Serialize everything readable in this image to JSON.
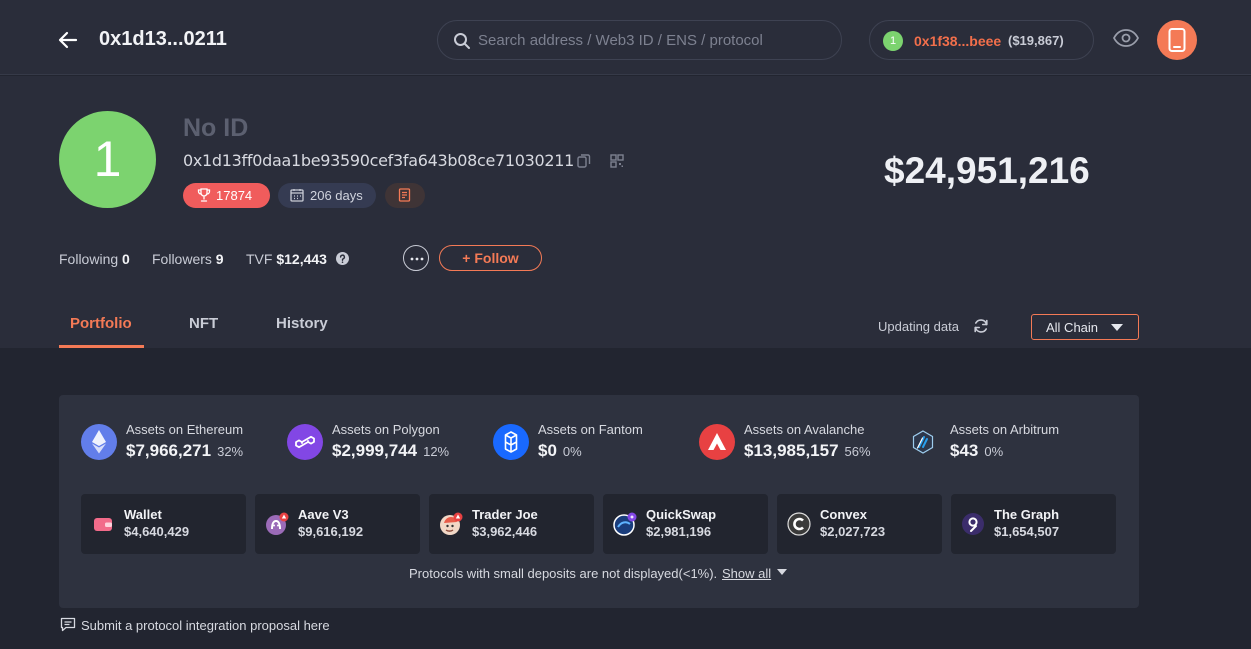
{
  "header": {
    "address_short": "0x1d13...0211",
    "search_placeholder": "Search address / Web3 ID / ENS / protocol",
    "account": {
      "avatar_number": "1",
      "address": "0x1f38...beee",
      "balance": "($19,867)"
    }
  },
  "profile": {
    "avatar_number": "1",
    "id_label": "No ID",
    "full_address": "0x1d13ff0daa1be93590cef3fa643b08ce71030211",
    "rank": "17874",
    "age": "206 days",
    "net_worth": "$24,951,216",
    "following_label": "Following",
    "following_count": "0",
    "followers_label": "Followers",
    "followers_count": "9",
    "tvf_label": "TVF",
    "tvf_value": "$12,443",
    "follow_label": "+ Follow"
  },
  "tabs": [
    {
      "label": "Portfolio",
      "active": true
    },
    {
      "label": "NFT",
      "active": false
    },
    {
      "label": "History",
      "active": false
    }
  ],
  "status": {
    "updating_label": "Updating data",
    "chain_filter": "All Chain"
  },
  "chains": [
    {
      "label": "Assets on Ethereum",
      "value": "$7,966,271",
      "pct": "32%",
      "color": "#627eea",
      "icon": "ethereum-icon"
    },
    {
      "label": "Assets on Polygon",
      "value": "$2,999,744",
      "pct": "12%",
      "color": "#8247e5",
      "icon": "polygon-icon"
    },
    {
      "label": "Assets on Fantom",
      "value": "$0",
      "pct": "0%",
      "color": "#1969ff",
      "icon": "fantom-icon"
    },
    {
      "label": "Assets on Avalanche",
      "value": "$13,985,157",
      "pct": "56%",
      "color": "#e84142",
      "icon": "avalanche-icon"
    },
    {
      "label": "Assets on Arbitrum",
      "value": "$43",
      "pct": "0%",
      "color": "#2d374b",
      "icon": "arbitrum-icon"
    }
  ],
  "protocols": [
    {
      "name": "Wallet",
      "value": "$4,640,429",
      "icon": "wallet-icon"
    },
    {
      "name": "Aave V3",
      "value": "$9,616,192",
      "icon": "aave-icon"
    },
    {
      "name": "Trader Joe",
      "value": "$3,962,446",
      "icon": "trader-joe-icon"
    },
    {
      "name": "QuickSwap",
      "value": "$2,981,196",
      "icon": "quickswap-icon"
    },
    {
      "name": "Convex",
      "value": "$2,027,723",
      "icon": "convex-icon"
    },
    {
      "name": "The Graph",
      "value": "$1,654,507",
      "icon": "the-graph-icon"
    }
  ],
  "notes": {
    "small_deposits": "Protocols with small deposits are not displayed(<1%).",
    "show_all": "Show all",
    "submit_proposal": "Submit a protocol integration proposal here"
  },
  "colors": {
    "accent": "#f47a56",
    "avatar_green": "#7cd36f",
    "rank_badge": "#f05c5c"
  }
}
